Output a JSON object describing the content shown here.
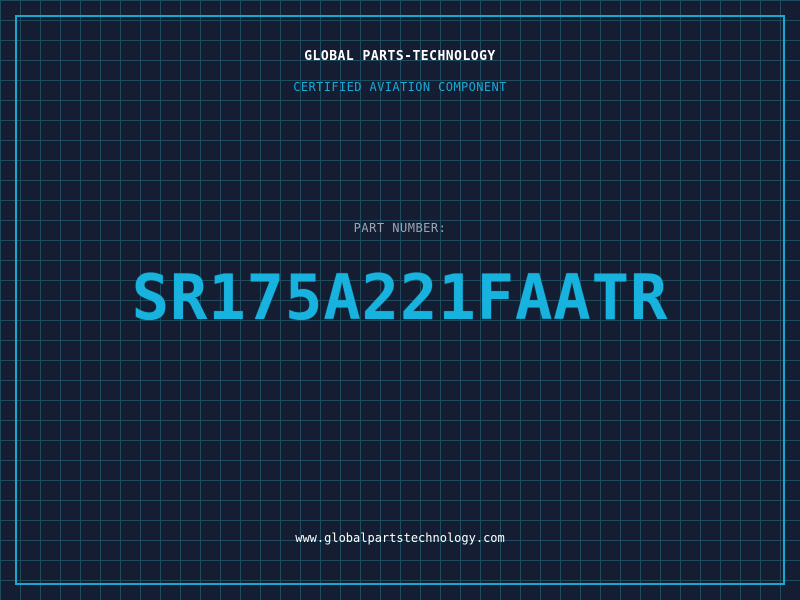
{
  "header": {
    "brand": "GLOBAL PARTS-TECHNOLOGY",
    "subtitle": "CERTIFIED AVIATION COMPONENT"
  },
  "part": {
    "label": "PART NUMBER:",
    "number": "SR175A221FAATR"
  },
  "footer": {
    "url": "www.globalpartstechnology.com"
  },
  "colors": {
    "background": "#141d31",
    "grid": "#1d4d5e",
    "accent": "#17a9d0",
    "text": "#ffffff",
    "label": "#9aa6b6"
  }
}
